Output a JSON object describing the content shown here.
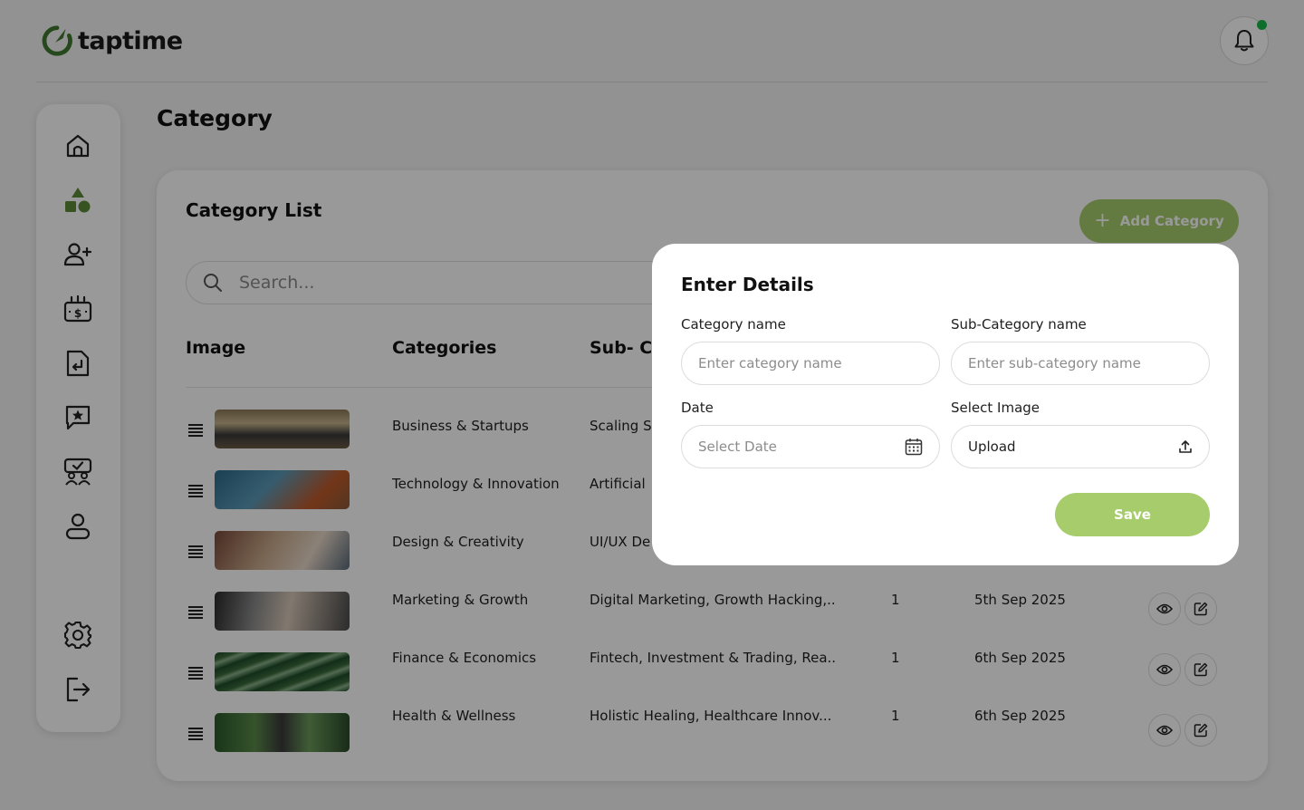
{
  "app": {
    "name": "taptime",
    "brand_color": "#3f7a2f",
    "accent_color": "#a6cc6c",
    "notification_dot_color": "#1bb84a"
  },
  "header": {
    "notification_icon": "bell-icon"
  },
  "sidebar": {
    "items": [
      {
        "icon": "home-icon"
      },
      {
        "icon": "category-shapes-icon",
        "active": true
      },
      {
        "icon": "add-user-icon"
      },
      {
        "icon": "budget-icon"
      },
      {
        "icon": "document-return-icon"
      },
      {
        "icon": "review-star-icon"
      },
      {
        "icon": "group-check-icon"
      },
      {
        "icon": "profile-icon"
      },
      {
        "icon": "settings-icon"
      },
      {
        "icon": "logout-icon"
      }
    ]
  },
  "page": {
    "title": "Category"
  },
  "list": {
    "title": "Category List",
    "add_button": "Add Category",
    "search_placeholder": "Search...",
    "columns": {
      "image": "Image",
      "categories": "Categories",
      "subcategories": "Sub- Categories"
    },
    "rows": [
      {
        "category": "Business & Startups",
        "subcategories": "Scaling S",
        "count": "",
        "date": ""
      },
      {
        "category": "Technology & Innovation",
        "subcategories": "Artificial",
        "count": "",
        "date": ""
      },
      {
        "category": "Design & Creativity",
        "subcategories": "UI/UX De",
        "count": "",
        "date": ""
      },
      {
        "category": "Marketing & Growth",
        "subcategories": "Digital Marketing, Growth Hacking,..",
        "count": "1",
        "date": "5th Sep 2025"
      },
      {
        "category": "Finance & Economics",
        "subcategories": "Fintech, Investment & Trading, Rea..",
        "count": "1",
        "date": "6th Sep 2025"
      },
      {
        "category": "Health & Wellness",
        "subcategories": "Holistic Healing, Healthcare Innov...",
        "count": "1",
        "date": "6th Sep 2025"
      }
    ]
  },
  "modal": {
    "title": "Enter Details",
    "category_label": "Category name",
    "category_placeholder": "Enter category name",
    "subcategory_label": "Sub-Category name",
    "subcategory_placeholder": "Enter sub-category name",
    "date_label": "Date",
    "date_placeholder": "Select Date",
    "image_label": "Select Image",
    "image_value": "Upload",
    "save_button": "Save"
  }
}
